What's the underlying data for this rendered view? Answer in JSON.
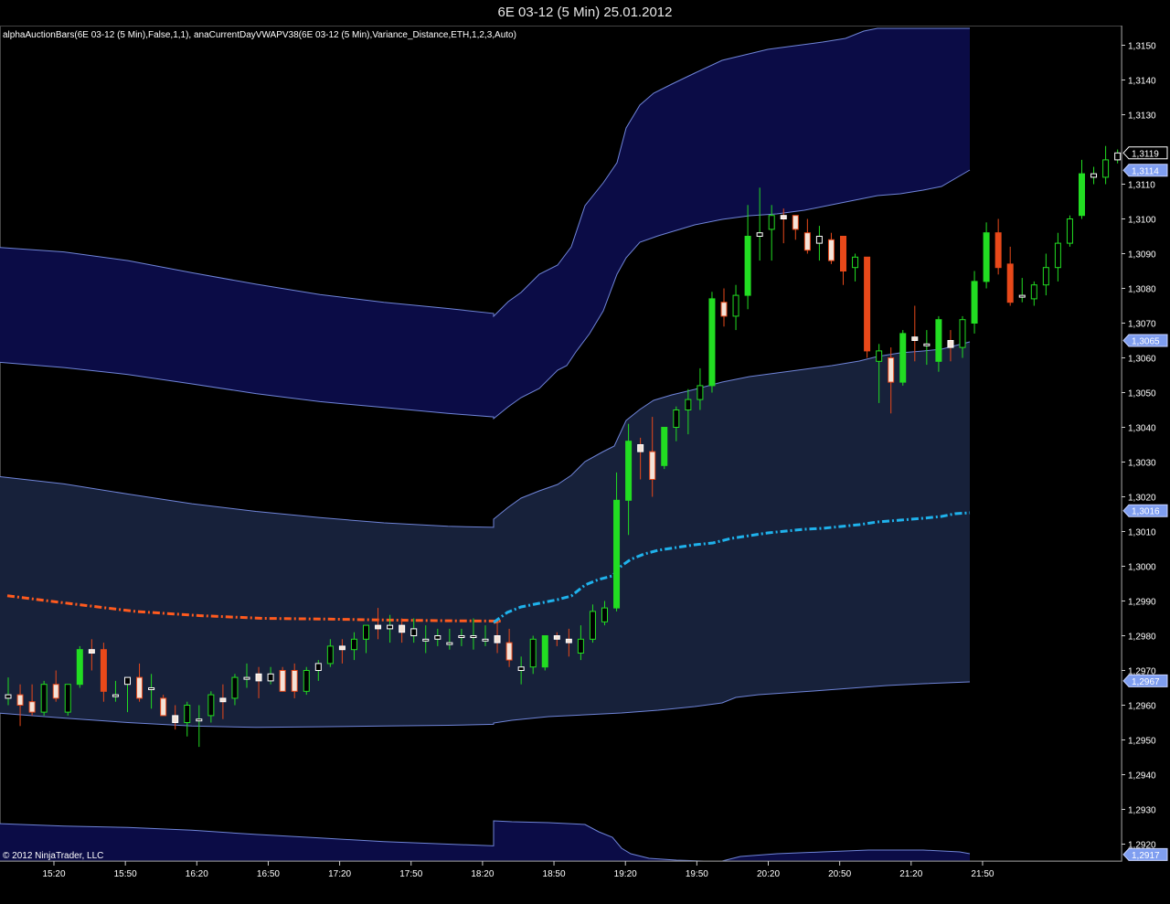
{
  "window": {
    "title": "6E 03-12 (5 Min)  25.01.2012"
  },
  "indicator_label": "alphaAuctionBars(6E 03-12 (5 Min),False,1,1), anaCurrentDayVWAPV38(6E 03-12 (5 Min),Variance_Distance,ETH,1,2,3,Auto)",
  "copyright": "© 2012 NinjaTrader, LLC",
  "colors": {
    "background": "#000000",
    "outer_band_fill": "#0b0c46",
    "inner_band_fill": "#17213a",
    "band_line": "#6f84d8",
    "vwap_prior": "#ff5a1e",
    "vwap_current": "#1fb2ec",
    "up_candle": "#22dd22",
    "down_candle": "#e8491a",
    "price_marker": "#7f9ef0"
  },
  "chart_data": {
    "type": "candlestick",
    "title": "6E 03-12 (5 Min)  25.01.2012",
    "xlabel": "",
    "ylabel": "",
    "ylim": [
      1.2912,
      1.3155
    ],
    "grid": false,
    "y_ticks": [
      "1,3150",
      "1,3140",
      "1,3130",
      "1,3110",
      "1,3100",
      "1,3090",
      "1,3080",
      "1,3070",
      "1,3060",
      "1,3050",
      "1,3040",
      "1,3030",
      "1,3020",
      "1,3010",
      "1,3000",
      "1,2990",
      "1,2980",
      "1,2970",
      "1,2960",
      "1,2950",
      "1,2940",
      "1,2930",
      "1,2920"
    ],
    "y_tick_values": [
      1.315,
      1.314,
      1.313,
      1.311,
      1.31,
      1.309,
      1.308,
      1.307,
      1.306,
      1.305,
      1.304,
      1.303,
      1.302,
      1.301,
      1.3,
      1.299,
      1.298,
      1.297,
      1.296,
      1.295,
      1.294,
      1.293,
      1.292
    ],
    "x_ticks": [
      "15:20",
      "15:50",
      "16:20",
      "16:50",
      "17:20",
      "17:50",
      "18:20",
      "18:50",
      "19:20",
      "19:50",
      "20:20",
      "20:50",
      "21:20",
      "21:50"
    ],
    "price_markers": [
      {
        "label": "1,3119",
        "value": 1.3119,
        "style": "outline"
      },
      {
        "label": "1,3114",
        "value": 1.3114,
        "style": "filled"
      },
      {
        "label": "1,3065",
        "value": 1.3065,
        "style": "filled"
      },
      {
        "label": "1,3016",
        "value": 1.3016,
        "style": "filled"
      },
      {
        "label": "1,2967",
        "value": 1.2967,
        "style": "filled"
      },
      {
        "label": "1,2917",
        "value": 1.2917,
        "style": "filled"
      }
    ],
    "bars": [
      [
        1.2962,
        1.2968,
        1.296,
        1.2963
      ],
      [
        1.2963,
        1.2966,
        1.2954,
        1.296
      ],
      [
        1.2961,
        1.2966,
        1.2957,
        1.2958
      ],
      [
        1.2958,
        1.2967,
        1.2957,
        1.2966
      ],
      [
        1.2966,
        1.297,
        1.2961,
        1.2962
      ],
      [
        1.2958,
        1.2966,
        1.2957,
        1.2966
      ],
      [
        1.2966,
        1.2977,
        1.2965,
        1.2976
      ],
      [
        1.2976,
        1.2979,
        1.297,
        1.2975
      ],
      [
        1.2976,
        1.2978,
        1.2961,
        1.2964
      ],
      [
        1.2963,
        1.2967,
        1.2961,
        1.2963
      ],
      [
        1.2966,
        1.2968,
        1.2958,
        1.2968
      ],
      [
        1.2968,
        1.2972,
        1.2961,
        1.2962
      ],
      [
        1.2965,
        1.2969,
        1.2959,
        1.2965
      ],
      [
        1.2962,
        1.2963,
        1.2957,
        1.2957
      ],
      [
        1.2957,
        1.296,
        1.2953,
        1.2955
      ],
      [
        1.2955,
        1.2961,
        1.2951,
        1.296
      ],
      [
        1.2956,
        1.296,
        1.2948,
        1.2956
      ],
      [
        1.2957,
        1.2964,
        1.2955,
        1.2963
      ],
      [
        1.2962,
        1.2966,
        1.2956,
        1.2961
      ],
      [
        1.2962,
        1.2969,
        1.296,
        1.2968
      ],
      [
        1.2968,
        1.2972,
        1.2965,
        1.2968
      ],
      [
        1.2969,
        1.2971,
        1.2962,
        1.2967
      ],
      [
        1.2967,
        1.2971,
        1.2966,
        1.2969
      ],
      [
        1.297,
        1.2971,
        1.2964,
        1.2964
      ],
      [
        1.297,
        1.2972,
        1.2962,
        1.2964
      ],
      [
        1.2964,
        1.2971,
        1.2963,
        1.297
      ],
      [
        1.297,
        1.2973,
        1.2967,
        1.2972
      ],
      [
        1.2972,
        1.2979,
        1.2971,
        1.2977
      ],
      [
        1.2977,
        1.2979,
        1.2972,
        1.2976
      ],
      [
        1.2976,
        1.2981,
        1.2973,
        1.2979
      ],
      [
        1.2979,
        1.2982,
        1.2975,
        1.2983
      ],
      [
        1.2983,
        1.2988,
        1.2979,
        1.2982
      ],
      [
        1.2982,
        1.2986,
        1.2978,
        1.2983
      ],
      [
        1.2983,
        1.2985,
        1.2978,
        1.2981
      ],
      [
        1.298,
        1.2985,
        1.2978,
        1.2982
      ],
      [
        1.2979,
        1.2983,
        1.2975,
        1.2979
      ],
      [
        1.2979,
        1.2982,
        1.2977,
        1.298
      ],
      [
        1.2978,
        1.2982,
        1.2976,
        1.2978
      ],
      [
        1.298,
        1.2982,
        1.2977,
        1.298
      ],
      [
        1.298,
        1.2985,
        1.2976,
        1.298
      ],
      [
        1.2979,
        1.2983,
        1.2977,
        1.2979
      ],
      [
        1.298,
        1.2984,
        1.2975,
        1.2978
      ],
      [
        1.2978,
        1.2982,
        1.2971,
        1.2973
      ],
      [
        1.297,
        1.2974,
        1.2966,
        1.2971
      ],
      [
        1.2971,
        1.298,
        1.2969,
        1.2979
      ],
      [
        1.2971,
        1.298,
        1.297,
        1.298
      ],
      [
        1.298,
        1.2981,
        1.2977,
        1.2979
      ],
      [
        1.2979,
        1.2982,
        1.2974,
        1.2978
      ],
      [
        1.2975,
        1.2983,
        1.2973,
        1.2979
      ],
      [
        1.2979,
        1.2989,
        1.2978,
        1.2987
      ],
      [
        1.2984,
        1.299,
        1.2983,
        1.2988
      ],
      [
        1.2988,
        1.3027,
        1.2987,
        1.3019
      ],
      [
        1.3019,
        1.3041,
        1.3009,
        1.3036
      ],
      [
        1.3035,
        1.3037,
        1.3025,
        1.3033
      ],
      [
        1.3033,
        1.3043,
        1.302,
        1.3025
      ],
      [
        1.3029,
        1.304,
        1.3028,
        1.304
      ],
      [
        1.304,
        1.3046,
        1.3036,
        1.3045
      ],
      [
        1.3045,
        1.3051,
        1.3038,
        1.3048
      ],
      [
        1.3048,
        1.3057,
        1.3045,
        1.3052
      ],
      [
        1.3052,
        1.3079,
        1.305,
        1.3077
      ],
      [
        1.3076,
        1.308,
        1.3069,
        1.3072
      ],
      [
        1.3072,
        1.3081,
        1.3068,
        1.3078
      ],
      [
        1.3078,
        1.3104,
        1.3074,
        1.3095
      ],
      [
        1.3095,
        1.3109,
        1.3088,
        1.3096
      ],
      [
        1.3097,
        1.3104,
        1.3088,
        1.3101
      ],
      [
        1.3101,
        1.3103,
        1.3093,
        1.31
      ],
      [
        1.3101,
        1.3101,
        1.3094,
        1.3097
      ],
      [
        1.3096,
        1.31,
        1.309,
        1.3091
      ],
      [
        1.3093,
        1.3098,
        1.3088,
        1.3095
      ],
      [
        1.3094,
        1.3096,
        1.3087,
        1.3088
      ],
      [
        1.3095,
        1.3095,
        1.3081,
        1.3085
      ],
      [
        1.3086,
        1.309,
        1.3082,
        1.3089
      ],
      [
        1.3089,
        1.3089,
        1.306,
        1.3062
      ],
      [
        1.3059,
        1.3064,
        1.3047,
        1.3062
      ],
      [
        1.306,
        1.3063,
        1.3044,
        1.3053
      ],
      [
        1.3053,
        1.3068,
        1.3052,
        1.3067
      ],
      [
        1.3066,
        1.3075,
        1.3059,
        1.3065
      ],
      [
        1.3064,
        1.3068,
        1.3058,
        1.3064
      ],
      [
        1.3059,
        1.3072,
        1.3056,
        1.3071
      ],
      [
        1.3065,
        1.3068,
        1.3059,
        1.3063
      ],
      [
        1.3063,
        1.3072,
        1.306,
        1.3071
      ],
      [
        1.307,
        1.3085,
        1.3067,
        1.3082
      ],
      [
        1.3082,
        1.3099,
        1.308,
        1.3096
      ],
      [
        1.3096,
        1.31,
        1.3084,
        1.3086
      ],
      [
        1.3087,
        1.3092,
        1.3075,
        1.3076
      ],
      [
        1.3078,
        1.3083,
        1.3076,
        1.3078
      ],
      [
        1.3077,
        1.3082,
        1.3075,
        1.3081
      ],
      [
        1.3081,
        1.309,
        1.3078,
        1.3086
      ],
      [
        1.3086,
        1.3096,
        1.3082,
        1.3093
      ],
      [
        1.3093,
        1.3101,
        1.3092,
        1.31
      ],
      [
        1.3101,
        1.3117,
        1.31,
        1.3113
      ],
      [
        1.3112,
        1.3115,
        1.311,
        1.3113
      ],
      [
        1.3112,
        1.3121,
        1.311,
        1.3117
      ],
      [
        1.3117,
        1.312,
        1.3116,
        1.3119
      ]
    ],
    "bands": {
      "outer_upper_prior": [
        1.30918,
        1.30905,
        1.3088,
        1.30845,
        1.30812,
        1.30782,
        1.3076,
        1.30742,
        1.30728
      ],
      "inner_upper_prior": [
        1.30587,
        1.30572,
        1.30552,
        1.30525,
        1.30497,
        1.30474,
        1.30457,
        1.3044,
        1.3043
      ],
      "ring1_upper_prior": [
        1.30258,
        1.30237,
        1.30208,
        1.3018,
        1.30158,
        1.3014,
        1.30125,
        1.30115,
        1.30112
      ],
      "ring1_lower_prior": [
        1.29577,
        1.29563,
        1.2955,
        1.2954,
        1.29536,
        1.29538,
        1.2954,
        1.29542,
        1.29545
      ],
      "outer_lower_prior": [
        1.29259,
        1.29252,
        1.29248,
        1.2924,
        1.29228,
        1.29218,
        1.29207,
        1.292,
        1.29195
      ],
      "vwap_prior": [
        1.29915,
        1.29892,
        1.2987,
        1.29858,
        1.2985,
        1.29848,
        1.29845,
        1.29843,
        1.29842
      ]
    }
  }
}
